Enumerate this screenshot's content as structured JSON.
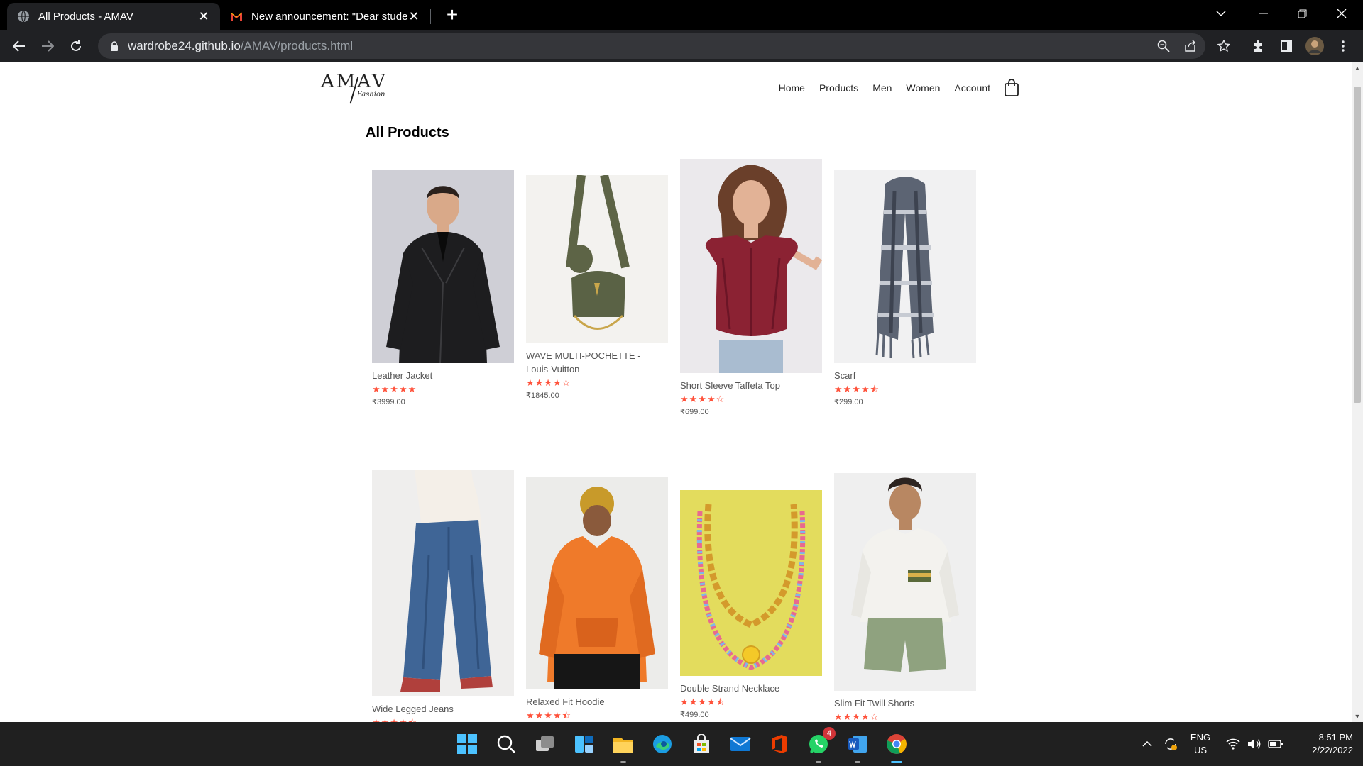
{
  "browser": {
    "tabs": [
      {
        "title": "All Products - AMAV",
        "icon": "globe-icon",
        "active": true
      },
      {
        "title": "New announcement: \"Dear stude",
        "icon": "gmail-icon",
        "active": false
      }
    ],
    "url_domain": "wardrobe24.github.io",
    "url_path": "/AMAV/products.html"
  },
  "site": {
    "logo_main": "AMAV",
    "logo_sub": "Fashion",
    "nav": [
      "Home",
      "Products",
      "Men",
      "Women",
      "Account"
    ],
    "heading": "All Products"
  },
  "products": [
    {
      "name": "Leather Jacket",
      "stars": "★★★★★",
      "price": "₹3999.00",
      "rating": 5,
      "image": "leather-jacket"
    },
    {
      "name": "WAVE MULTI-POCHETTE - Louis-Vuitton",
      "stars": "★★★★☆",
      "price": "₹1845.00",
      "rating": 4,
      "image": "bag"
    },
    {
      "name": "Short Sleeve Taffeta Top",
      "stars": "★★★★☆",
      "price": "₹699.00",
      "rating": 4,
      "image": "taffeta-top"
    },
    {
      "name": "Scarf",
      "stars": "★★★★⯪",
      "price": "₹299.00",
      "rating": 4.5,
      "image": "scarf"
    },
    {
      "name": "Wide Legged Jeans",
      "stars": "★★★★⯪",
      "price": "",
      "rating": 4.5,
      "image": "jeans"
    },
    {
      "name": "Relaxed Fit Hoodie",
      "stars": "★★★★⯪",
      "price": "",
      "rating": 4.5,
      "image": "hoodie"
    },
    {
      "name": "Double Strand Necklace",
      "stars": "★★★★⯪",
      "price": "₹499.00",
      "rating": 4.5,
      "image": "necklace"
    },
    {
      "name": "Slim Fit Twill Shorts",
      "stars": "★★★★☆",
      "price": "",
      "rating": 4,
      "image": "shorts"
    }
  ],
  "taskbar": {
    "apps": [
      "windows-start",
      "search",
      "task-view",
      "widgets",
      "file-explorer",
      "edge",
      "store",
      "mail",
      "office",
      "whatsapp",
      "word",
      "chrome"
    ],
    "whatsapp_badge": "4",
    "lang_top": "ENG",
    "lang_bottom": "US",
    "time": "8:51 PM",
    "date": "2/22/2022"
  },
  "colors": {
    "star": "#ff523b",
    "chrome_dark": "#202124",
    "taskbar": "#202020"
  }
}
